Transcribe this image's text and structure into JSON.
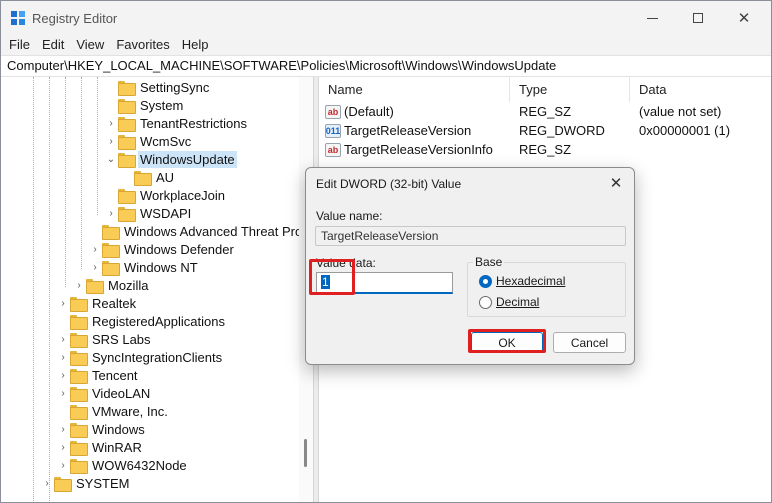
{
  "window": {
    "title": "Registry Editor",
    "controls": {
      "minimize": "minimize",
      "maximize": "maximize",
      "close": "✕"
    }
  },
  "menu": [
    "File",
    "Edit",
    "View",
    "Favorites",
    "Help"
  ],
  "address": "Computer\\HKEY_LOCAL_MACHINE\\SOFTWARE\\Policies\\Microsoft\\Windows\\WindowsUpdate",
  "tree": {
    "items": [
      {
        "label": "SettingSync",
        "chevron": ""
      },
      {
        "label": "System",
        "chevron": ""
      },
      {
        "label": "TenantRestrictions",
        "chevron": "›"
      },
      {
        "label": "WcmSvc",
        "chevron": "›"
      },
      {
        "label": "WindowsUpdate",
        "chevron": "⌄"
      },
      {
        "label": "AU",
        "chevron": ""
      },
      {
        "label": "WorkplaceJoin",
        "chevron": ""
      },
      {
        "label": "WSDAPI",
        "chevron": "›"
      },
      {
        "label": "Windows Advanced Threat Prote",
        "chevron": ""
      },
      {
        "label": "Windows Defender",
        "chevron": "›"
      },
      {
        "label": "Windows NT",
        "chevron": "›"
      },
      {
        "label": "Mozilla",
        "chevron": "›"
      },
      {
        "label": "Realtek",
        "chevron": "›"
      },
      {
        "label": "RegisteredApplications",
        "chevron": ""
      },
      {
        "label": "SRS Labs",
        "chevron": "›"
      },
      {
        "label": "SyncIntegrationClients",
        "chevron": "›"
      },
      {
        "label": "Tencent",
        "chevron": "›"
      },
      {
        "label": "VideoLAN",
        "chevron": "›"
      },
      {
        "label": "VMware, Inc.",
        "chevron": ""
      },
      {
        "label": "Windows",
        "chevron": "›"
      },
      {
        "label": "WinRAR",
        "chevron": "›"
      },
      {
        "label": "WOW6432Node",
        "chevron": "›"
      },
      {
        "label": "SYSTEM",
        "chevron": "›"
      }
    ]
  },
  "list": {
    "headers": {
      "name": "Name",
      "type": "Type",
      "data": "Data"
    },
    "rows": [
      {
        "icon": "string-value-icon",
        "glyph": "ab",
        "name": "(Default)",
        "type": "REG_SZ",
        "data": "(value not set)"
      },
      {
        "icon": "dword-value-icon",
        "glyph": "011",
        "name": "TargetReleaseVersion",
        "type": "REG_DWORD",
        "data": "0x00000001 (1)"
      },
      {
        "icon": "string-value-icon",
        "glyph": "ab",
        "name": "TargetReleaseVersionInfo",
        "type": "REG_SZ",
        "data": ""
      }
    ]
  },
  "dialog": {
    "title": "Edit DWORD (32-bit) Value",
    "close": "✕",
    "value_name_label": "Value name:",
    "value_name": "TargetReleaseVersion",
    "value_data_label": "Value data:",
    "value_data": "1",
    "base_label": "Base",
    "base_options": [
      {
        "label": "Hexadecimal",
        "checked": true
      },
      {
        "label": "Decimal",
        "checked": false
      }
    ],
    "ok_label": "OK",
    "cancel_label": "Cancel"
  },
  "colors": {
    "highlight": "#e02020",
    "accent": "#0067c0",
    "selection": "#cce4f7"
  }
}
